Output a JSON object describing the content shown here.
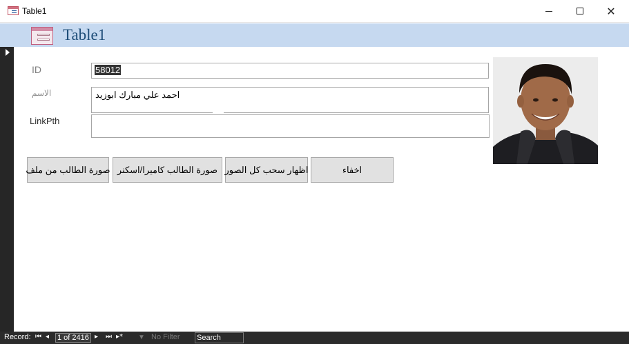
{
  "window": {
    "title": "Table1"
  },
  "header": {
    "title": "Table1"
  },
  "form": {
    "id_label": "ID",
    "id_value": "58012",
    "name_label": "الاسم",
    "name_value": "احمد علي مبارك ابوزيد",
    "link_label": "LinkPth",
    "link_value": ""
  },
  "buttons": {
    "from_file": "صورة الطالب من ملف",
    "camera_scanner": "صورة الطالب  كاميرا/اسكنر",
    "show_all": "اظهار سحب كل الصور",
    "hide": "اخفاء"
  },
  "status": {
    "record_label": "Record:",
    "position": "1 of 2416",
    "filter": "No Filter",
    "search_placeholder": "Search"
  },
  "colors": {
    "header_bg": "#c6d9f0",
    "header_title": "#1f4e79",
    "status_bg": "#2b2b2b",
    "button_bg": "#e1e1e1"
  }
}
